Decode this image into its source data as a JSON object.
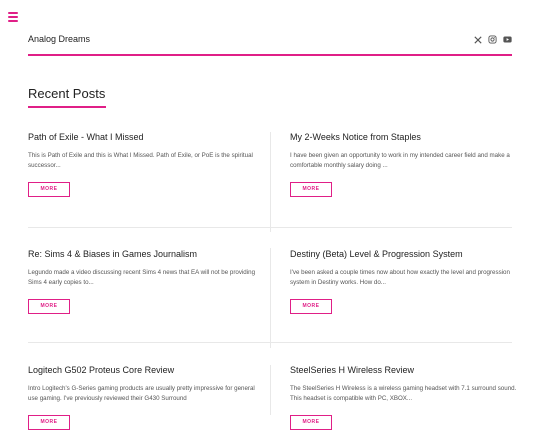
{
  "header": {
    "site_title": "Analog Dreams",
    "social_icons": [
      "x-icon",
      "instagram-icon",
      "youtube-icon"
    ]
  },
  "section": {
    "title": "Recent Posts"
  },
  "colors": {
    "accent": "#e01f87"
  },
  "posts": [
    {
      "title": "Path of Exile - What I Missed",
      "excerpt": "This is Path of Exile and this is What I Missed. Path of Exile, or PoE is the spiritual successor...",
      "more": "MORE"
    },
    {
      "title": "My 2-Weeks Notice from Staples",
      "excerpt": "I have been given an opportunity to work in my intended career field and make a comfortable monthly salary doing ...",
      "more": "MORE"
    },
    {
      "title": "Re: Sims 4 & Biases in Games Journalism",
      "excerpt": "Legundo made a video discussing recent Sims 4 news that EA will not be providing Sims 4 early copies to...",
      "more": "MORE"
    },
    {
      "title": "Destiny (Beta) Level & Progression System",
      "excerpt": "I've been asked a couple times now about how exactly the level and progression system in Destiny works. How do...",
      "more": "MORE"
    },
    {
      "title": "Logitech G502 Proteus Core Review",
      "excerpt": "Intro Logitech's G-Series gaming products are usually pretty impressive for general use gaming. I've previously reviewed their G430 Surround",
      "more": "MORE"
    },
    {
      "title": "SteelSeries H Wireless Review",
      "excerpt": "The SteelSeries H Wireless is a wireless gaming headset with 7.1 surround sound. This headset is compatible with PC, XBOX...",
      "more": "MORE"
    }
  ]
}
